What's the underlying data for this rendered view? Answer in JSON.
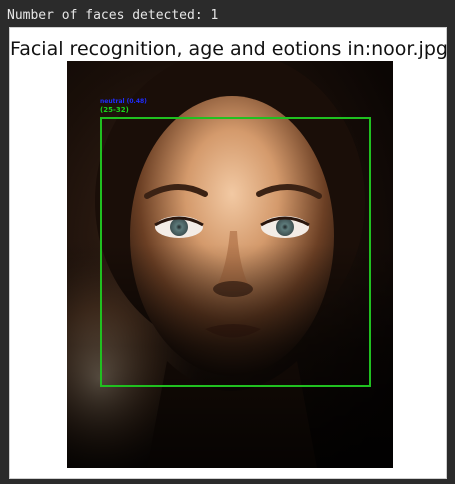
{
  "stdout": {
    "text": "Number of faces detected: 1"
  },
  "figure": {
    "title": "Facial recognition, age and eotions in:noor.jpg"
  },
  "detection": {
    "emotion_label": "neutral (0.48)",
    "age_label": "(25-32)",
    "box_color": "#20c020",
    "emotion_color": "#1f2cff",
    "age_color": "#18d41a"
  }
}
